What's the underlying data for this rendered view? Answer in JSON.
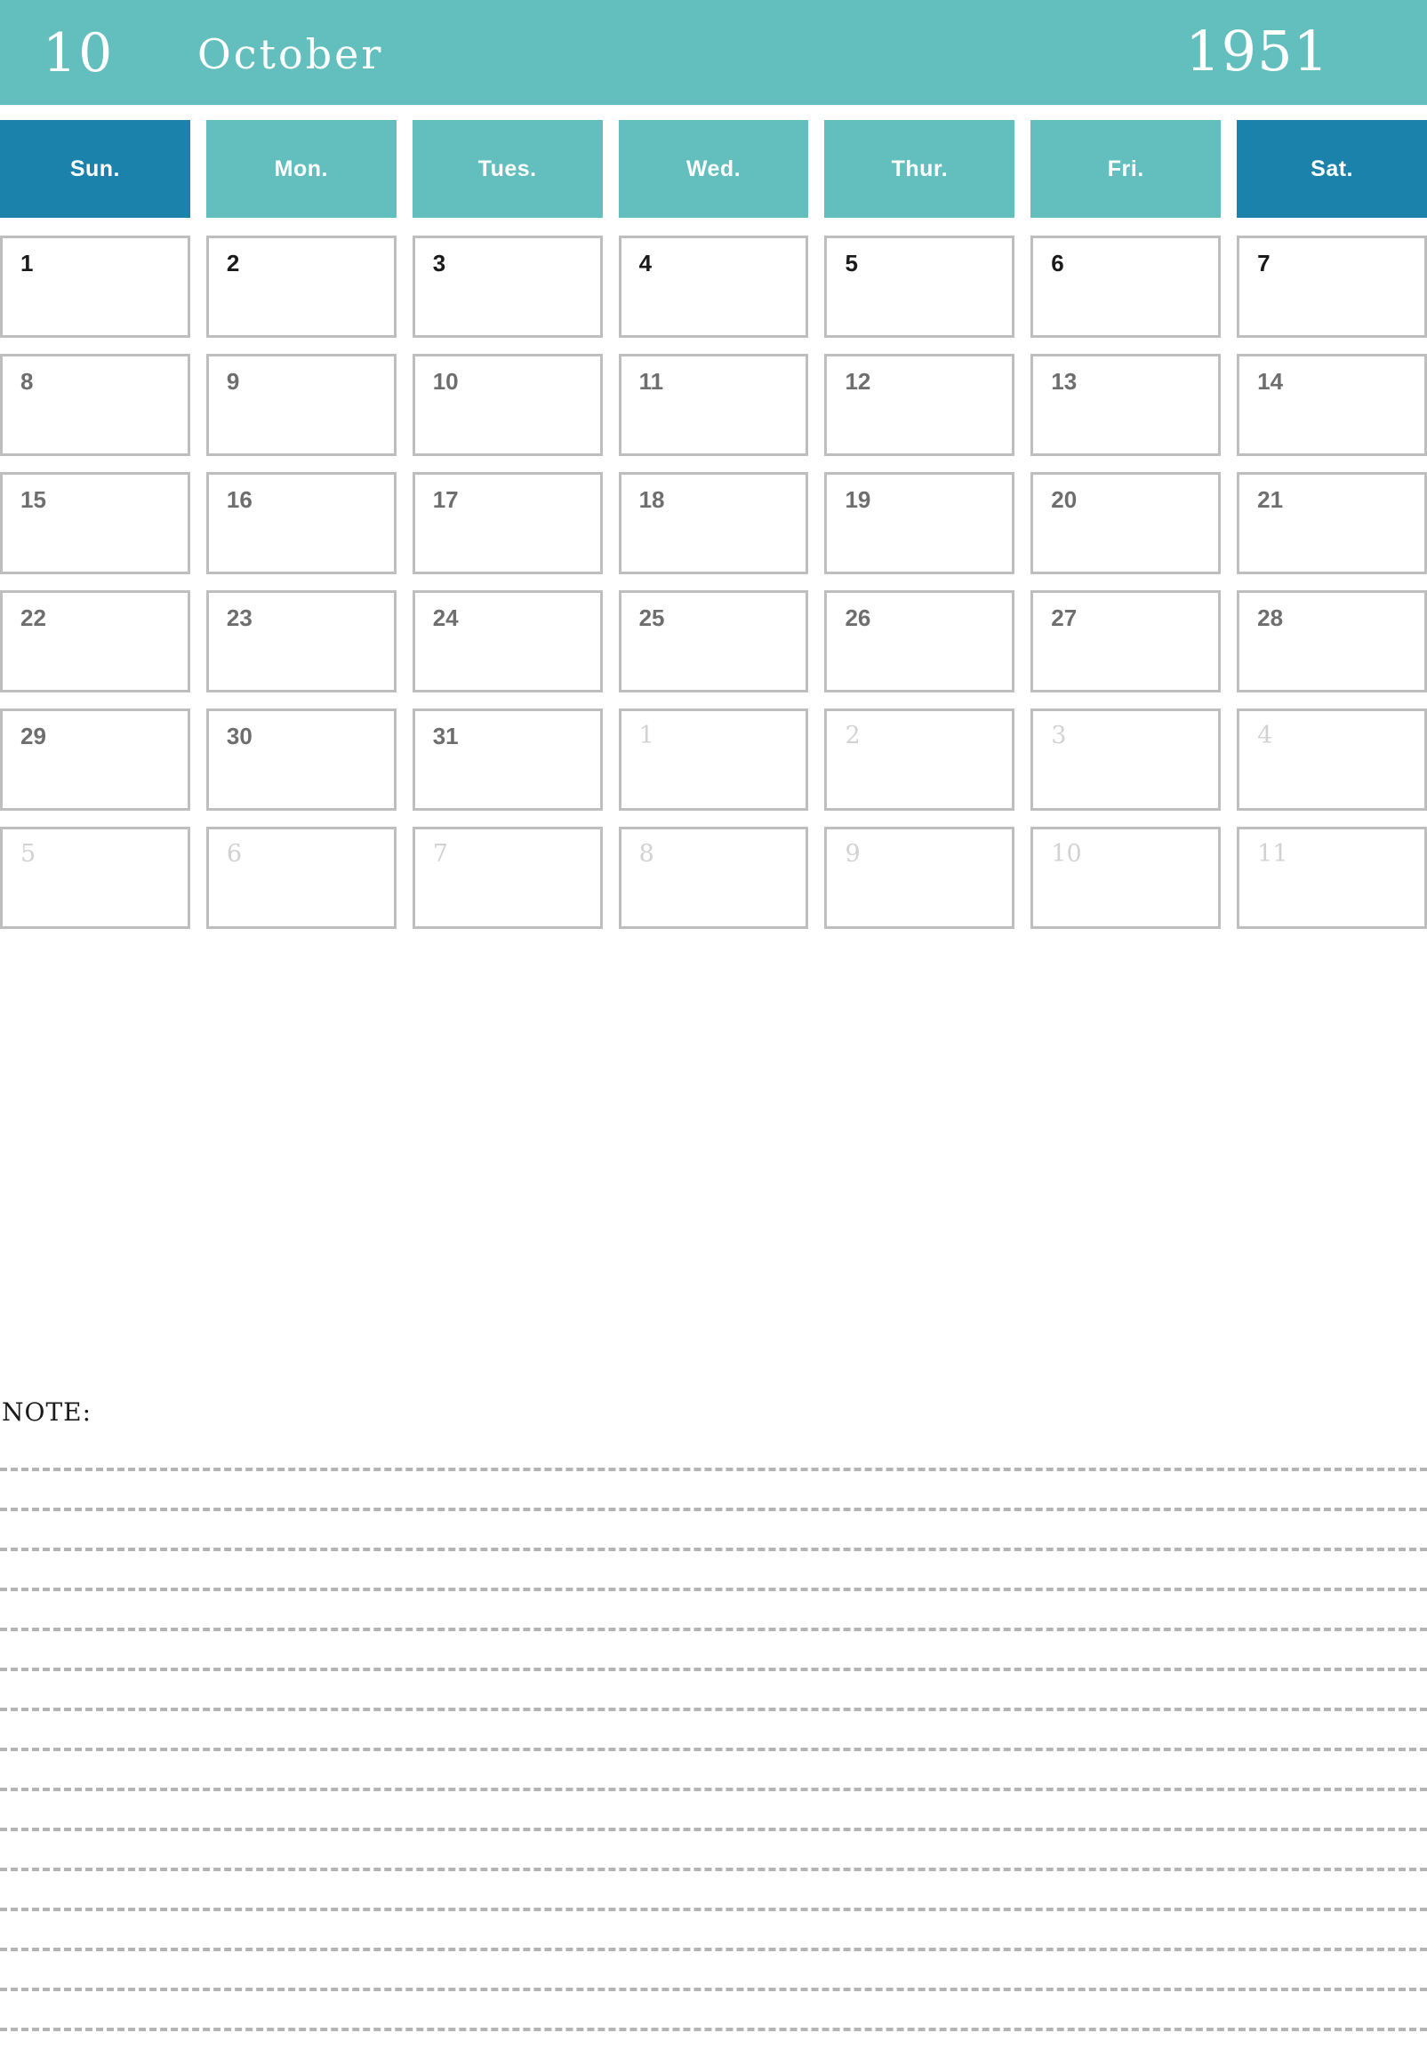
{
  "header": {
    "month_number": "10",
    "month_name": "October",
    "year": "1951",
    "band_color": "#62bfbd"
  },
  "colors": {
    "accent_teal": "#62bfbd",
    "accent_blue": "#1b83ab",
    "cell_border": "#bebebe",
    "day_text": "#6e6e6e",
    "day_text_first_week": "#1a1a1a",
    "other_month_text": "#d2d2d2",
    "note_line": "#b4b4b4"
  },
  "weekdays": [
    {
      "label": "Sun.",
      "weekend": true
    },
    {
      "label": "Mon.",
      "weekend": false
    },
    {
      "label": "Tues.",
      "weekend": false
    },
    {
      "label": "Wed.",
      "weekend": false
    },
    {
      "label": "Thur.",
      "weekend": false
    },
    {
      "label": "Fri.",
      "weekend": false
    },
    {
      "label": "Sat.",
      "weekend": true
    }
  ],
  "weeks": [
    [
      {
        "n": "1",
        "other": false
      },
      {
        "n": "2",
        "other": false
      },
      {
        "n": "3",
        "other": false
      },
      {
        "n": "4",
        "other": false
      },
      {
        "n": "5",
        "other": false
      },
      {
        "n": "6",
        "other": false
      },
      {
        "n": "7",
        "other": false
      }
    ],
    [
      {
        "n": "8",
        "other": false
      },
      {
        "n": "9",
        "other": false
      },
      {
        "n": "10",
        "other": false
      },
      {
        "n": "11",
        "other": false
      },
      {
        "n": "12",
        "other": false
      },
      {
        "n": "13",
        "other": false
      },
      {
        "n": "14",
        "other": false
      }
    ],
    [
      {
        "n": "15",
        "other": false
      },
      {
        "n": "16",
        "other": false
      },
      {
        "n": "17",
        "other": false
      },
      {
        "n": "18",
        "other": false
      },
      {
        "n": "19",
        "other": false
      },
      {
        "n": "20",
        "other": false
      },
      {
        "n": "21",
        "other": false
      }
    ],
    [
      {
        "n": "22",
        "other": false
      },
      {
        "n": "23",
        "other": false
      },
      {
        "n": "24",
        "other": false
      },
      {
        "n": "25",
        "other": false
      },
      {
        "n": "26",
        "other": false
      },
      {
        "n": "27",
        "other": false
      },
      {
        "n": "28",
        "other": false
      }
    ],
    [
      {
        "n": "29",
        "other": false
      },
      {
        "n": "30",
        "other": false
      },
      {
        "n": "31",
        "other": false
      },
      {
        "n": "1",
        "other": true
      },
      {
        "n": "2",
        "other": true
      },
      {
        "n": "3",
        "other": true
      },
      {
        "n": "4",
        "other": true
      }
    ],
    [
      {
        "n": "5",
        "other": true
      },
      {
        "n": "6",
        "other": true
      },
      {
        "n": "7",
        "other": true
      },
      {
        "n": "8",
        "other": true
      },
      {
        "n": "9",
        "other": true
      },
      {
        "n": "10",
        "other": true
      },
      {
        "n": "11",
        "other": true
      }
    ]
  ],
  "note": {
    "label": "NOTE:",
    "line_count": 16
  }
}
